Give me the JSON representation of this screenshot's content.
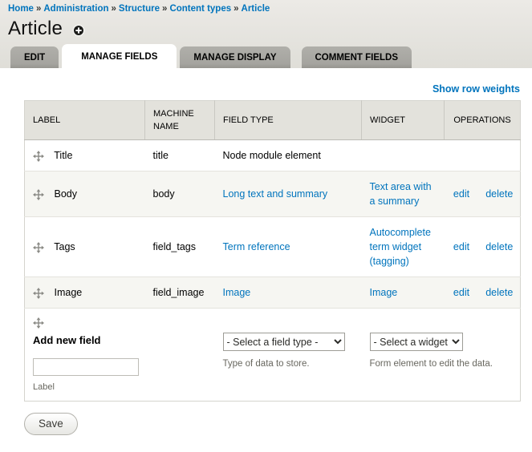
{
  "breadcrumb": {
    "separator": "»",
    "items": [
      "Home",
      "Administration",
      "Structure",
      "Content types",
      "Article"
    ]
  },
  "page": {
    "title": "Article"
  },
  "tabs": [
    {
      "label": "EDIT"
    },
    {
      "label": "MANAGE FIELDS"
    },
    {
      "label": "MANAGE DISPLAY"
    },
    {
      "label": "COMMENT FIELDS"
    }
  ],
  "content": {
    "show_row_weights_label": "Show row weights"
  },
  "fields_table": {
    "headers": {
      "label": "LABEL",
      "machine_name": "MACHINE NAME",
      "field_type": "FIELD TYPE",
      "widget": "WIDGET",
      "operations": "OPERATIONS"
    },
    "rows": [
      {
        "label": "Title",
        "machine_name": "title",
        "field_type": "Node module element",
        "widget": "",
        "edit_label": "",
        "delete_label": ""
      },
      {
        "label": "Body",
        "machine_name": "body",
        "field_type": "Long text and summary",
        "widget": "Text area with a summary",
        "edit_label": "edit",
        "delete_label": "delete"
      },
      {
        "label": "Tags",
        "machine_name": "field_tags",
        "field_type": "Term reference",
        "widget": "Autocomplete term widget (tagging)",
        "edit_label": "edit",
        "delete_label": "delete"
      },
      {
        "label": "Image",
        "machine_name": "field_image",
        "field_type": "Image",
        "widget": "Image",
        "edit_label": "edit",
        "delete_label": "delete"
      }
    ],
    "add_new_field": {
      "title": "Add new field",
      "label_input_value": "",
      "label_input_caption": "Label",
      "field_type_selected": "- Select a field type -",
      "field_type_description": "Type of data to store.",
      "widget_selected": "- Select a widget -",
      "widget_description": "Form element to edit the data."
    }
  },
  "actions": {
    "save_label": "Save"
  },
  "colors": {
    "link_blue": "#0074BD",
    "header_band": "#e0dfd9",
    "tab_inactive": "#a8a7a2",
    "table_header_bg": "#e3e2dc",
    "row_stripe": "#f6f6f2"
  }
}
